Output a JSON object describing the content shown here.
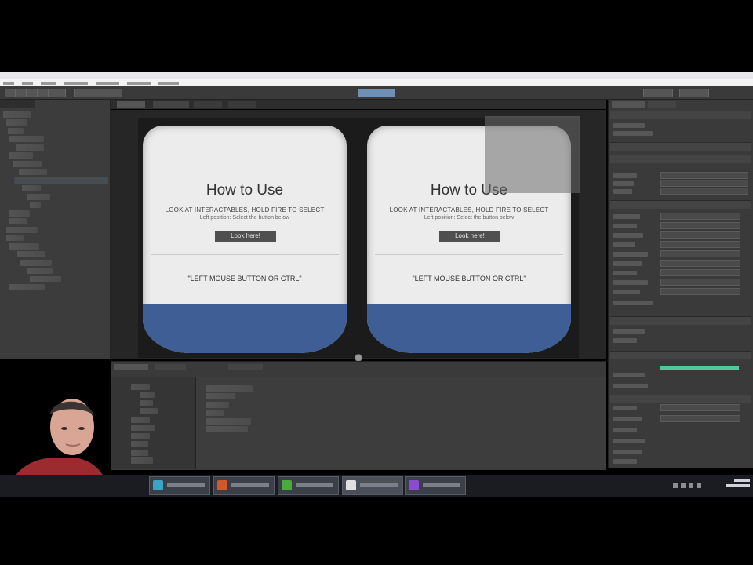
{
  "scene": {
    "left_lens": {
      "heading": "How to Use",
      "instruction": "LOOK AT INTERACTABLES, HOLD FIRE TO SELECT",
      "instruction_sub": "Left position: Select the button below",
      "button": "Look here!",
      "mouse_hint": "\"LEFT MOUSE BUTTON OR CTRL\""
    },
    "right_lens": {
      "heading": "How to Use",
      "instruction": "LOOK AT INTERACTABLES, HOLD FIRE TO SELECT",
      "instruction_sub": "Left position: Select the button below",
      "button": "Look here!",
      "mouse_hint": "\"LEFT MOUSE BUTTON OR CTRL\""
    }
  },
  "colors": {
    "floor": "#3e5e95",
    "play_button": "#6f8fb4",
    "accent_green": "#4fc99b"
  },
  "taskbar": {
    "icons": [
      "start-icon",
      "unity-icon",
      "folder-icon",
      "browser-icon",
      "editor-icon",
      "unity-editor-icon",
      "visual-studio-icon"
    ]
  }
}
